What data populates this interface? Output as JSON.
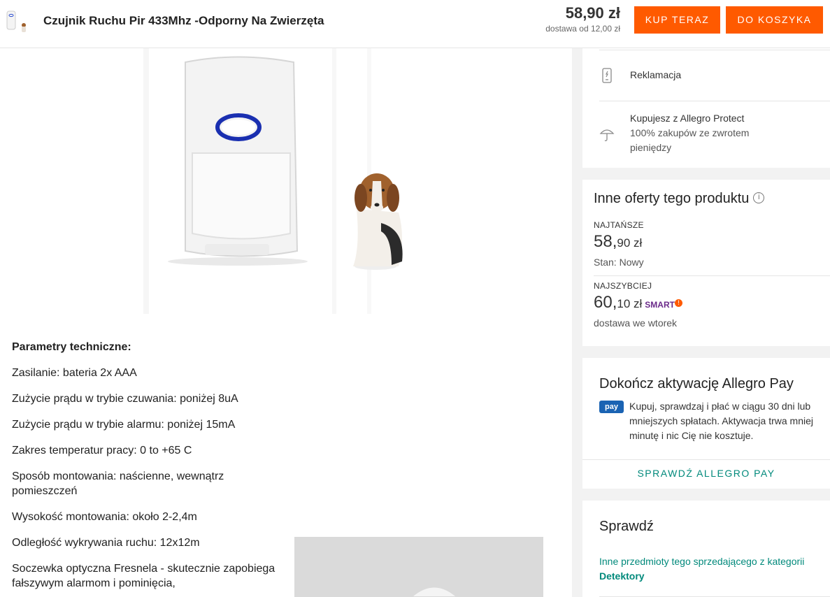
{
  "header": {
    "title": "Czujnik Ruchu Pir 433Mhz -Odporny Na Zwierzęta",
    "price": "58,90 zł",
    "shipping": "dostawa od 12,00 zł",
    "buy_label": "KUP TERAZ",
    "cart_label": "DO KOSZYKA"
  },
  "params": {
    "title": "Parametry techniczne:",
    "lines": [
      "Zasilanie: bateria 2x AAA",
      "Zużycie prądu w trybie czuwania: poniżej 8uA",
      "Zużycie prądu w trybie alarmu: poniżej 15mA",
      "Zakres temperatur pracy: 0 to +65 C",
      "Sposób montowania: naścienne, wewnątrz pomieszczeń",
      "Wysokość montowania: około 2-2,4m",
      "Odległość wykrywania ruchu: 12x12m",
      "Soczewka optyczna Fresnela - skutecznie zapobiega fałszywym alarmom i pominięcia,"
    ]
  },
  "sidebar": {
    "returns": {
      "complaint_label": "Reklamacja",
      "protect_title": "Kupujesz z Allegro Protect",
      "protect_desc": "100% zakupów ze zwrotem pieniędzy"
    },
    "other_offers": {
      "title": "Inne oferty tego produktu",
      "cheapest_label": "NAJTAŃSZE",
      "cheapest_price_main": "58,",
      "cheapest_price_rest": "90 zł",
      "cheapest_condition": "Stan: Nowy",
      "fastest_label": "NAJSZYBCIEJ",
      "fastest_price_main": "60,",
      "fastest_price_rest": "10 zł",
      "smart_label": "SMART",
      "fastest_delivery": "dostawa we wtorek"
    },
    "allegro_pay": {
      "title": "Dokończ aktywację Allegro Pay",
      "badge": "pay",
      "text": "Kupuj, sprawdzaj i płać w ciągu 30 dni lub mniejszych spłatach. Aktywacja trwa mniej minutę i nic Cię nie kosztuje.",
      "link": "SPRAWDŹ ALLEGRO PAY"
    },
    "check": {
      "title": "Sprawdź",
      "link_text": "Inne przedmioty tego sprzedającego z kategorii",
      "link_category": "Detektory"
    }
  },
  "colors": {
    "accent": "#ff5a00",
    "link": "#00897b",
    "pay": "#1a63b3"
  }
}
